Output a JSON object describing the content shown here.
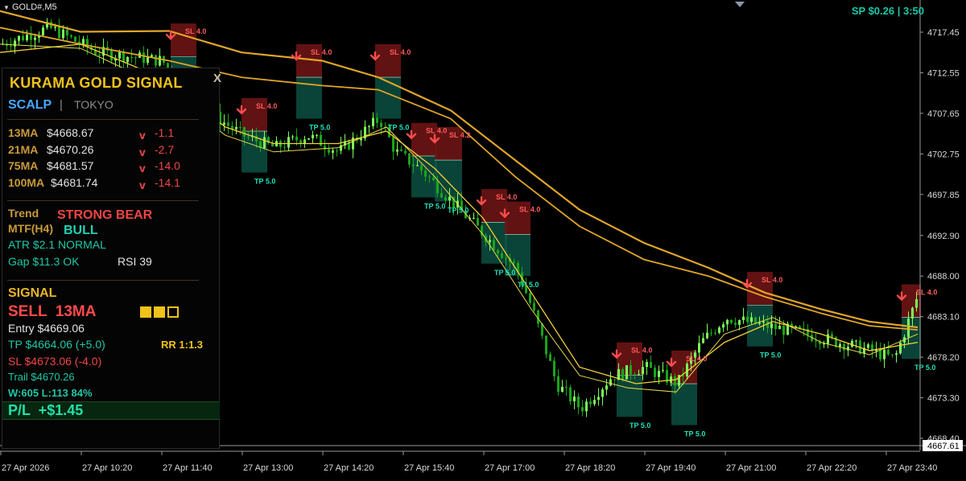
{
  "window": {
    "symbol_timeframe": "GOLD#,M5",
    "spread_time": "SP $0.26 | 3:50",
    "current_price_tag": "4667.61"
  },
  "colors": {
    "background": "#000000",
    "candle_bull": "#7cff5a",
    "candle_bear": "#1aa51a",
    "ma_fast": "#f2d13a",
    "ma_slow": "#e0a528",
    "sl_box": "#6b1414",
    "tp_box": "#0e5a4a",
    "sell_arrow": "#ff4d4d"
  },
  "price_axis": {
    "labels": [
      "4717.45",
      "4712.55",
      "4707.65",
      "4702.75",
      "4697.85",
      "4692.90",
      "4688.00",
      "4683.10",
      "4678.20",
      "4673.30",
      "4668.40"
    ]
  },
  "time_axis": {
    "labels": [
      "27 Apr 2026",
      "27 Apr 10:20",
      "27 Apr 11:40",
      "27 Apr 13:00",
      "27 Apr 14:20",
      "27 Apr 15:40",
      "27 Apr 17:00",
      "27 Apr 18:20",
      "27 Apr 19:40",
      "27 Apr 21:00",
      "27 Apr 22:20",
      "27 Apr 23:40"
    ]
  },
  "trade_marks": {
    "sl_label": "SL 4.0",
    "sl_label_alt": "SL 4.2",
    "tp_label": "TP 5.0"
  },
  "panel": {
    "title": "KURAMA GOLD SIGNAL",
    "close": "X",
    "mode": "SCALP",
    "mode_separator": "|",
    "session": "TOKYO",
    "ma_rows": [
      {
        "name": "13MA",
        "price": "$4668.67",
        "dir": "v",
        "change": "-1.1"
      },
      {
        "name": "21MA",
        "price": "$4670.26",
        "dir": "v",
        "change": "-2.7"
      },
      {
        "name": "75MA",
        "price": "$4681.57",
        "dir": "v",
        "change": "-14.0"
      },
      {
        "name": "100MA",
        "price": "$4681.74",
        "dir": "v",
        "change": "-14.1"
      }
    ],
    "trend_label": "Trend",
    "trend_value": "STRONG BEAR",
    "mtf_label": "MTF(H4)",
    "mtf_value": "BULL",
    "atr_text": "ATR  $2.1  NORMAL",
    "gap_text": "Gap $11.3 OK",
    "rsi_text": "RSI 39",
    "signal_label": "SIGNAL",
    "signal_value": "SELL  13MA",
    "strength_filled": 2,
    "strength_total": 3,
    "entry_text": "Entry  $4669.06",
    "tp_text": "TP  $4664.06  (+5.0)",
    "rr_text": "RR 1:1.3",
    "sl_text": "SL  $4673.06  (-4.0)",
    "trail_text": "Trail  $4670.26",
    "winloss_text": "W:605 L:113  84%",
    "pl_text": "P/L  +$1.45"
  }
}
